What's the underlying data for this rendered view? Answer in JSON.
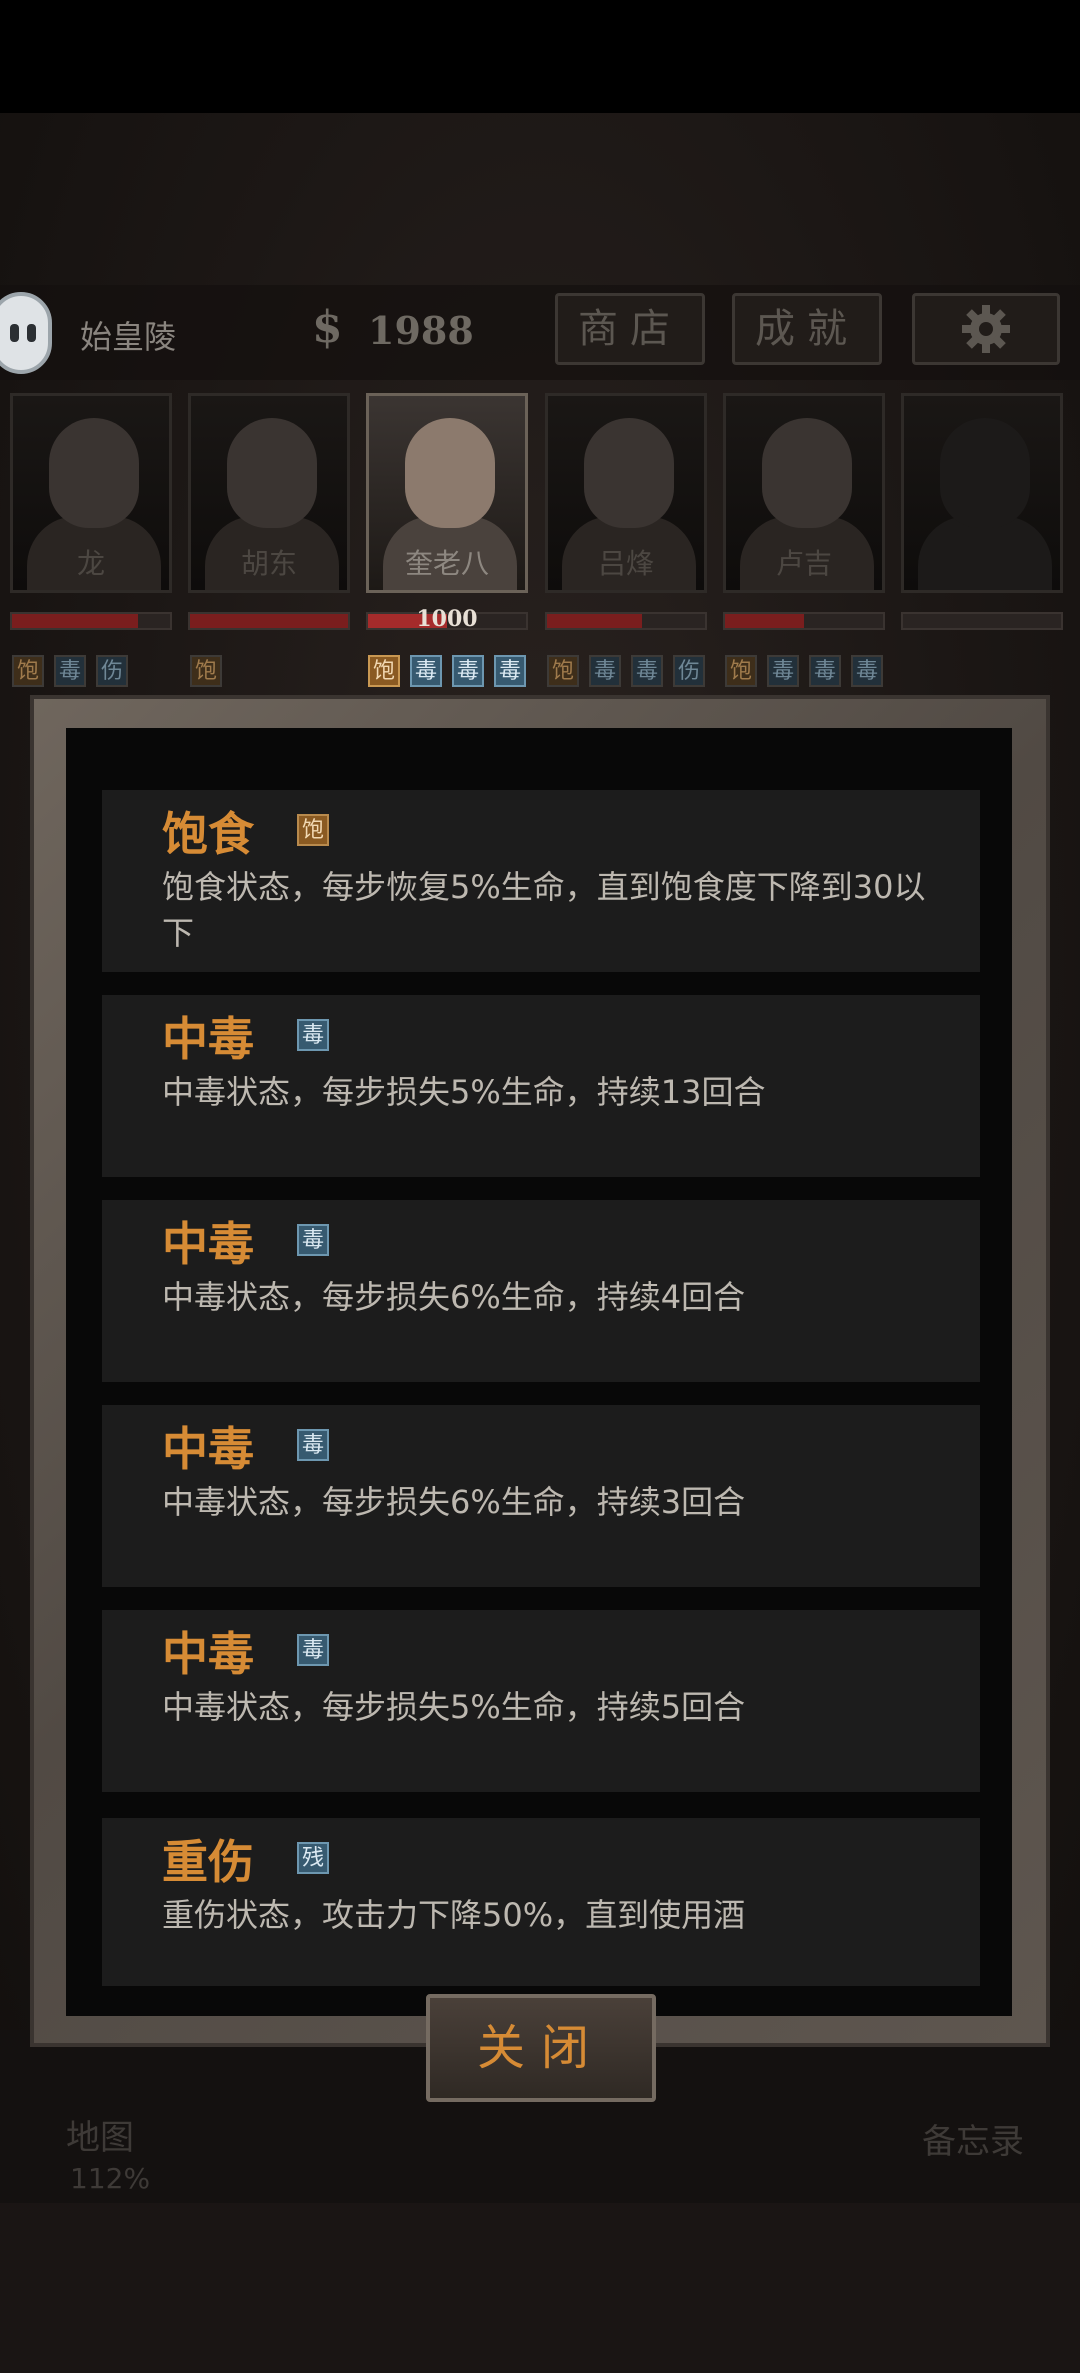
{
  "header": {
    "location": "始皇陵",
    "money_symbol": "$",
    "money": "1988",
    "shop_label": "商店",
    "achievement_label": "成就"
  },
  "party": [
    {
      "name": "龙",
      "hp_fraction": 0.8,
      "hp_text": "",
      "tags": [
        {
          "label": "饱",
          "kind": "full"
        },
        {
          "label": "毒",
          "kind": "poison"
        },
        {
          "label": "伤",
          "kind": "hurt"
        }
      ]
    },
    {
      "name": "胡东",
      "hp_fraction": 1.0,
      "hp_text": "",
      "tags": [
        {
          "label": "饱",
          "kind": "full"
        }
      ]
    },
    {
      "name": "奎老八",
      "hp_fraction": 0.5,
      "hp_text": "1000",
      "tags": [
        {
          "label": "饱",
          "kind": "full"
        },
        {
          "label": "毒",
          "kind": "poison"
        },
        {
          "label": "毒",
          "kind": "poison"
        },
        {
          "label": "毒",
          "kind": "poison"
        }
      ]
    },
    {
      "name": "吕烽",
      "hp_fraction": 0.6,
      "hp_text": "",
      "tags": [
        {
          "label": "饱",
          "kind": "full"
        },
        {
          "label": "毒",
          "kind": "poison"
        },
        {
          "label": "毒",
          "kind": "poison"
        },
        {
          "label": "伤",
          "kind": "hurt"
        }
      ]
    },
    {
      "name": "卢吉",
      "hp_fraction": 0.5,
      "hp_text": "",
      "tags": [
        {
          "label": "饱",
          "kind": "full"
        },
        {
          "label": "毒",
          "kind": "poison"
        },
        {
          "label": "毒",
          "kind": "poison"
        },
        {
          "label": "毒",
          "kind": "poison"
        }
      ]
    },
    {
      "name": "",
      "hp_fraction": 0,
      "hp_text": "",
      "tags": []
    }
  ],
  "effects": [
    {
      "title": "饱食",
      "tag": "饱",
      "kind": "full",
      "desc": "饱食状态，每步恢复5%生命，直到饱食度下降到30以下"
    },
    {
      "title": "中毒",
      "tag": "毒",
      "kind": "poison",
      "desc": "中毒状态，每步损失5%生命，持续13回合"
    },
    {
      "title": "中毒",
      "tag": "毒",
      "kind": "poison",
      "desc": "中毒状态，每步损失6%生命，持续4回合"
    },
    {
      "title": "中毒",
      "tag": "毒",
      "kind": "poison",
      "desc": "中毒状态，每步损失6%生命，持续3回合"
    },
    {
      "title": "中毒",
      "tag": "毒",
      "kind": "poison",
      "desc": "中毒状态，每步损失5%生命，持续5回合"
    },
    {
      "title": "重伤",
      "tag": "残",
      "kind": "poison",
      "desc": "重伤状态，攻击力下降50%，直到使用酒"
    }
  ],
  "nav": {
    "map_label": "地图",
    "map_zoom": "112%",
    "memo_label": "备忘录"
  },
  "close_label": "关闭"
}
